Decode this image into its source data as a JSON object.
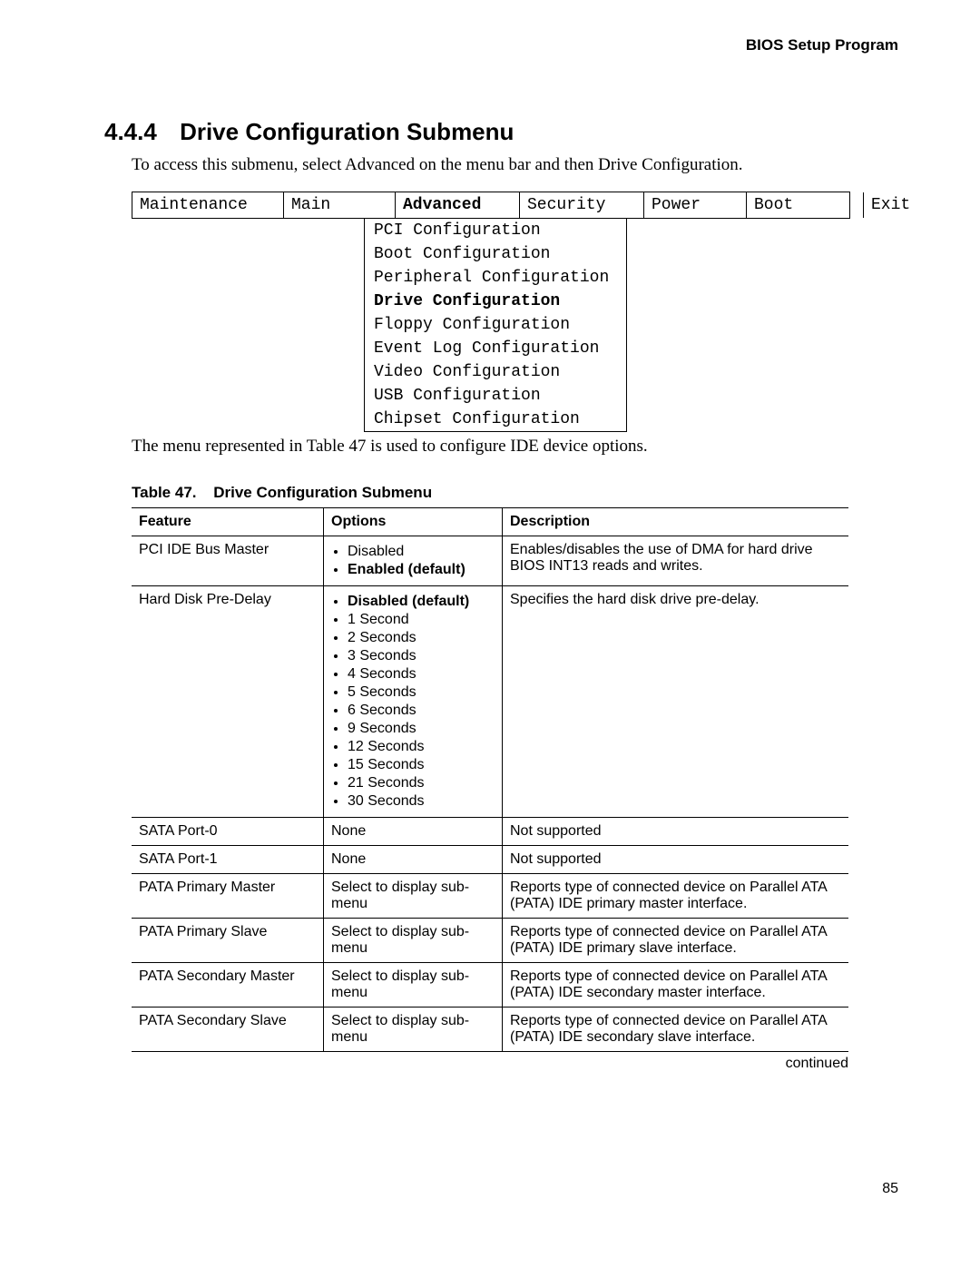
{
  "header": {
    "running_head": "BIOS Setup Program"
  },
  "section": {
    "number": "4.4.4",
    "title": "Drive Configuration Submenu"
  },
  "intro": "To access this submenu, select Advanced on the menu bar and then Drive Configuration.",
  "bios_menu": {
    "tabs": [
      "Maintenance",
      "Main",
      "Advanced",
      "Security",
      "Power",
      "Boot",
      "Exit"
    ],
    "active_tab": "Advanced",
    "submenu_items": [
      "PCI Configuration",
      "Boot Configuration",
      "Peripheral Configuration",
      "Drive Configuration",
      "Floppy Configuration",
      "Event Log Configuration",
      "Video Configuration",
      "USB Configuration",
      "Chipset Configuration"
    ],
    "selected_item": "Drive Configuration"
  },
  "description": "The menu represented in Table 47 is used to configure IDE device options.",
  "table": {
    "caption_number": "Table 47.",
    "caption_title": "Drive Configuration Submenu",
    "headers": [
      "Feature",
      "Options",
      "Description"
    ],
    "rows": [
      {
        "feature": "PCI IDE Bus Master",
        "options": [
          {
            "text": "Disabled",
            "bold": false
          },
          {
            "text": "Enabled (default)",
            "bold": true
          }
        ],
        "desc": "Enables/disables the use of DMA for hard drive BIOS INT13 reads and writes."
      },
      {
        "feature": "Hard Disk Pre-Delay",
        "options": [
          {
            "text": "Disabled (default)",
            "bold": true
          },
          {
            "text": "1 Second",
            "bold": false
          },
          {
            "text": "2 Seconds",
            "bold": false
          },
          {
            "text": "3 Seconds",
            "bold": false
          },
          {
            "text": "4 Seconds",
            "bold": false
          },
          {
            "text": "5 Seconds",
            "bold": false
          },
          {
            "text": "6 Seconds",
            "bold": false
          },
          {
            "text": "9 Seconds",
            "bold": false
          },
          {
            "text": "12 Seconds",
            "bold": false
          },
          {
            "text": "15 Seconds",
            "bold": false
          },
          {
            "text": "21 Seconds",
            "bold": false
          },
          {
            "text": "30 Seconds",
            "bold": false
          }
        ],
        "desc": "Specifies the hard disk drive pre-delay."
      },
      {
        "feature": "SATA Port-0",
        "options_plain": "None",
        "desc": "Not supported"
      },
      {
        "feature": "SATA Port-1",
        "options_plain": "None",
        "desc": "Not supported"
      },
      {
        "feature": "PATA Primary Master",
        "options_plain": "Select to display sub-menu",
        "desc": "Reports type of connected device on Parallel ATA (PATA) IDE primary master interface."
      },
      {
        "feature": "PATA Primary Slave",
        "options_plain": "Select to display sub-menu",
        "desc": "Reports type of connected device on Parallel ATA (PATA) IDE primary slave interface."
      },
      {
        "feature": "PATA Secondary Master",
        "options_plain": "Select to display sub-menu",
        "desc": "Reports type of connected device on Parallel ATA (PATA) IDE secondary master interface."
      },
      {
        "feature": "PATA Secondary Slave",
        "options_plain": "Select to display sub-menu",
        "desc": "Reports type of connected device on Parallel ATA (PATA) IDE secondary slave interface."
      }
    ],
    "continued": "continued"
  },
  "page_number": "85"
}
